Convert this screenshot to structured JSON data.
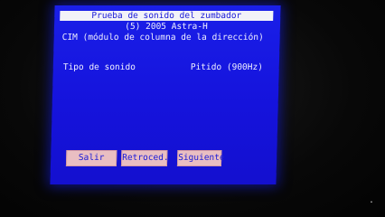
{
  "header": {
    "title": "Prueba de sonido del zumbador",
    "vehicle": "(5) 2005 Astra-H",
    "module": "CIM (módulo de columna de la dirección)"
  },
  "sound_test": {
    "label": "Tipo de sonido",
    "value": "Pitido (900Hz)"
  },
  "buttons": {
    "exit": "Salir",
    "back": "Retroced.",
    "next": "Siguiente"
  },
  "icons": {
    "device": "device-icon",
    "device_glyph": "⠂"
  },
  "colors": {
    "screen_blue": "#1a1fe8",
    "button_pink": "#e9bec2",
    "title_bar": "#f2f2f8"
  }
}
